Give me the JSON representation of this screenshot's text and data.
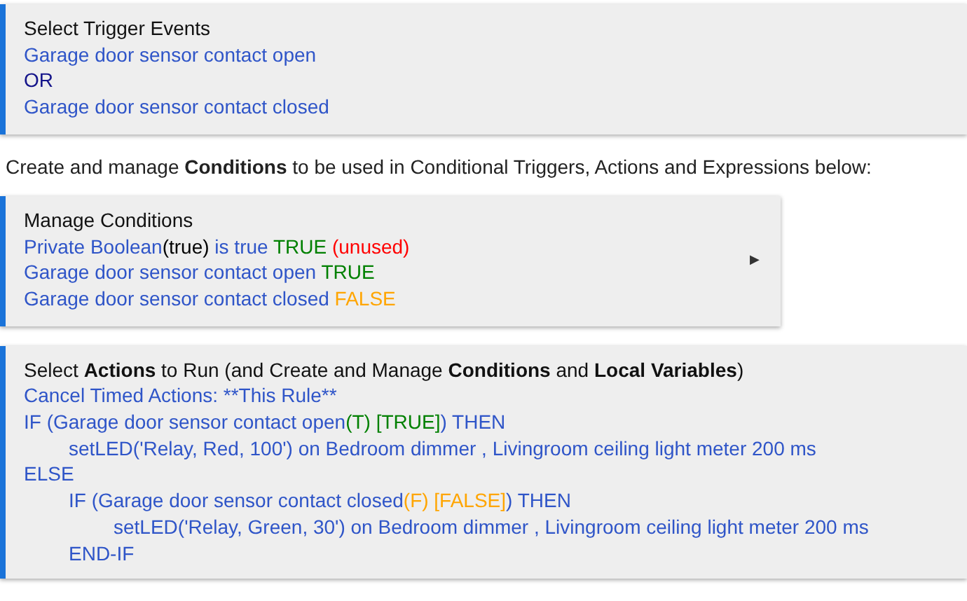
{
  "trigger_card": {
    "title": "Select Trigger Events",
    "lines": [
      {
        "segments": [
          {
            "text": "Garage door sensor contact open",
            "color": "#2f55c8"
          }
        ]
      },
      {
        "segments": [
          {
            "text": "OR",
            "color": "#14148a"
          }
        ]
      },
      {
        "segments": [
          {
            "text": "Garage door sensor contact closed",
            "color": "#2f55c8"
          }
        ]
      }
    ]
  },
  "intro": "Create and manage **Conditions** to be used in Conditional Triggers, Actions and Expressions below:",
  "conditions_card": {
    "title": "Manage Conditions",
    "expand_icon": "▶",
    "lines": [
      {
        "segments": [
          {
            "text": "Private Boolean",
            "color": "#2f55c8"
          },
          {
            "text": "(true)",
            "color": "#000000"
          },
          {
            "text": " is true ",
            "color": "#2f55c8"
          },
          {
            "text": "TRUE",
            "color": "#008000"
          },
          {
            "text": " (unused)",
            "color": "#ff0000"
          }
        ]
      },
      {
        "segments": [
          {
            "text": "Garage door sensor contact open ",
            "color": "#2f55c8"
          },
          {
            "text": "TRUE",
            "color": "#008000"
          }
        ]
      },
      {
        "segments": [
          {
            "text": "Garage door sensor contact closed ",
            "color": "#2f55c8"
          },
          {
            "text": "FALSE",
            "color": "#ffa500"
          }
        ]
      }
    ]
  },
  "actions_card": {
    "title": "Select **Actions** to Run (and Create and Manage **Conditions** and **Local Variables**)",
    "lines": [
      {
        "segments": [
          {
            "text": "Cancel Timed Actions: **This Rule**",
            "color": "#2f55c8"
          }
        ]
      },
      {
        "segments": [
          {
            "text": "IF (Garage door sensor contact open",
            "color": "#2f55c8"
          },
          {
            "text": "(T) [TRUE]",
            "color": "#008000"
          },
          {
            "text": ") THEN",
            "color": "#2f55c8"
          }
        ],
        "children": [
          {
            "segments": [
              {
                "text": "setLED('Relay, Red, 100') on Bedroom dimmer , Livingroom ceiling light meter 200 ms",
                "color": "#2f55c8"
              }
            ]
          }
        ]
      },
      {
        "segments": [
          {
            "text": "ELSE",
            "color": "#2f55c8"
          }
        ],
        "children": [
          {
            "segments": [
              {
                "text": "IF (Garage door sensor contact closed",
                "color": "#2f55c8"
              },
              {
                "text": "(F) [FALSE]",
                "color": "#ffa500"
              },
              {
                "text": ") THEN",
                "color": "#2f55c8"
              }
            ],
            "children": [
              {
                "segments": [
                  {
                    "text": "setLED('Relay, Green, 30') on Bedroom dimmer , Livingroom ceiling light meter 200 ms",
                    "color": "#2f55c8"
                  }
                ]
              }
            ]
          },
          {
            "segments": [
              {
                "text": "END-IF",
                "color": "#2f55c8"
              }
            ]
          }
        ]
      }
    ]
  }
}
